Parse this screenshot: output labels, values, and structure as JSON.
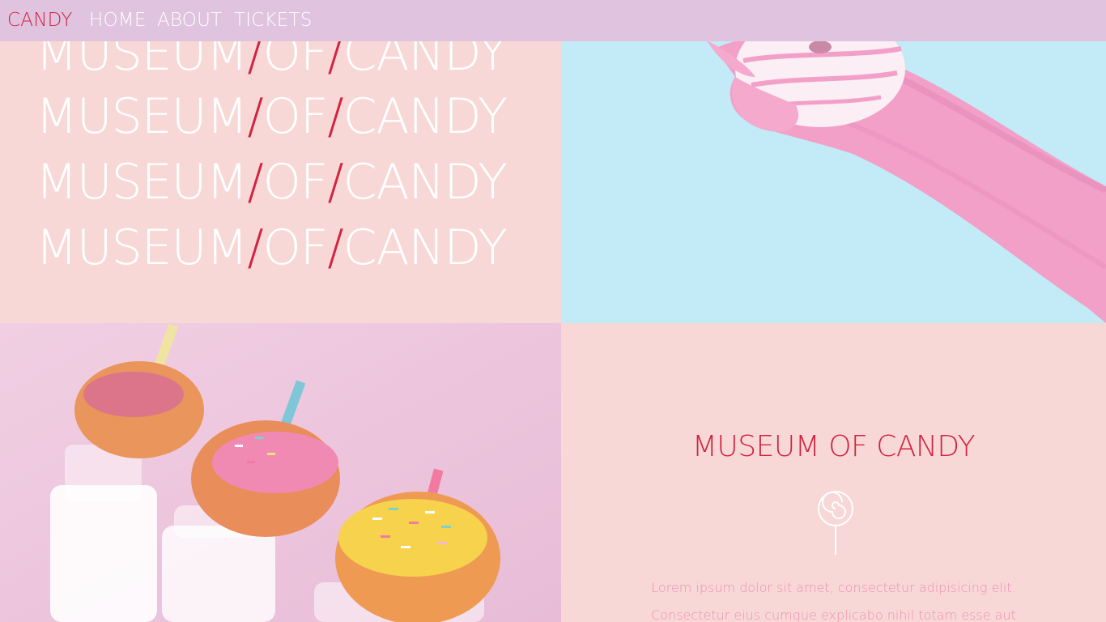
{
  "nav": {
    "brand": "CANDY",
    "links": [
      "HOME",
      "ABOUT",
      "TICKETS"
    ]
  },
  "hero": {
    "repeat_words": [
      "MUSEUM",
      "/",
      "OF",
      "/",
      "CANDY"
    ],
    "repeat_lines": 4
  },
  "images": {
    "top_right": "pink-glove-holding-donut-image",
    "bottom_left": "donuts-on-milk-bottles-image"
  },
  "info": {
    "title": "MUSEUM OF CANDY",
    "icon": "lollipop-icon",
    "text_1": "Lorem ipsum dolor sit amet, consectetur adipisicing elit.",
    "text_2": "Consectetur eius cumque explicabo nihil totam esse aut"
  },
  "colors": {
    "accent": "#d2233f",
    "nav_bg": "#dfc3df",
    "panel_pink": "#f7d8d6",
    "panel_blue": "#c2eaf7",
    "text_pink": "#ef8fb3"
  }
}
